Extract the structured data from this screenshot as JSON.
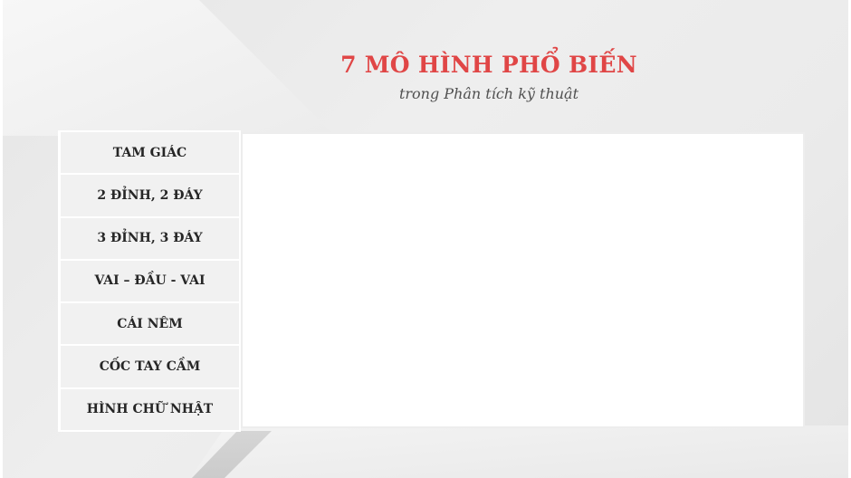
{
  "slide": {
    "title": "7 MÔ HÌNH PHỔ BIẾN",
    "subtitle": "trong Phân tích kỹ thuật"
  },
  "tabs": [
    {
      "label": "TAM GIÁC"
    },
    {
      "label": "2 ĐỈNH, 2 ĐÁY"
    },
    {
      "label": "3 ĐỈNH, 3 ĐÁY"
    },
    {
      "label": "VAI – ĐẦU - VAI"
    },
    {
      "label": "CÁI NÊM"
    },
    {
      "label": "CỐC TAY CẦM"
    },
    {
      "label": "HÌNH CHỮ NHẬT"
    }
  ],
  "colors": {
    "title": "#e04646",
    "subtitle": "#505050",
    "tab_background": "#f1f1f1",
    "tab_text": "#262626",
    "panel_background": "#ffffff"
  }
}
